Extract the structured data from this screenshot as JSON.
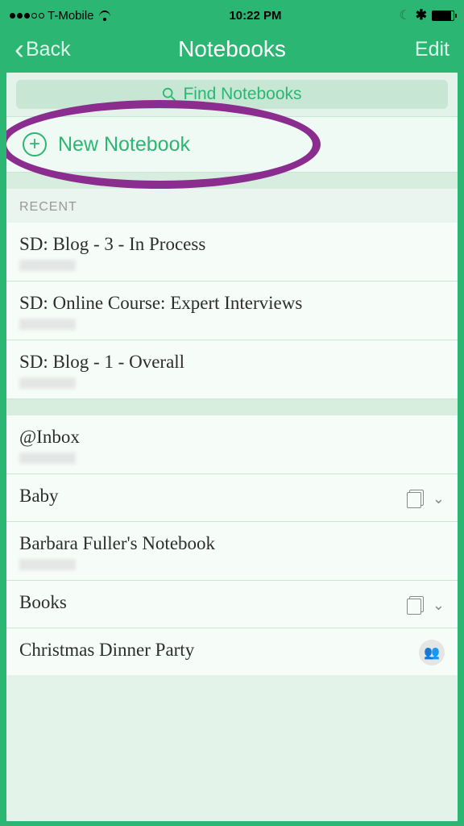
{
  "status": {
    "carrier": "T-Mobile",
    "time": "10:22 PM"
  },
  "nav": {
    "back": "Back",
    "title": "Notebooks",
    "edit": "Edit"
  },
  "search": {
    "placeholder": "Find Notebooks"
  },
  "new_notebook": {
    "label": "New Notebook"
  },
  "sections": {
    "recent_header": "RECENT",
    "recent": [
      {
        "title": "SD: Blog - 3 - In Process"
      },
      {
        "title": "SD: Online Course: Expert Interviews"
      },
      {
        "title": "SD: Blog - 1 - Overall"
      }
    ],
    "all": [
      {
        "title": "@Inbox",
        "has_stack": false,
        "has_share": false,
        "has_sub": true
      },
      {
        "title": "Baby",
        "has_stack": true,
        "has_share": false,
        "has_sub": false
      },
      {
        "title": "Barbara Fuller's Notebook",
        "has_stack": false,
        "has_share": false,
        "has_sub": true
      },
      {
        "title": "Books",
        "has_stack": true,
        "has_share": false,
        "has_sub": false
      },
      {
        "title": "Christmas Dinner Party",
        "has_stack": false,
        "has_share": true,
        "has_sub": false
      }
    ]
  }
}
